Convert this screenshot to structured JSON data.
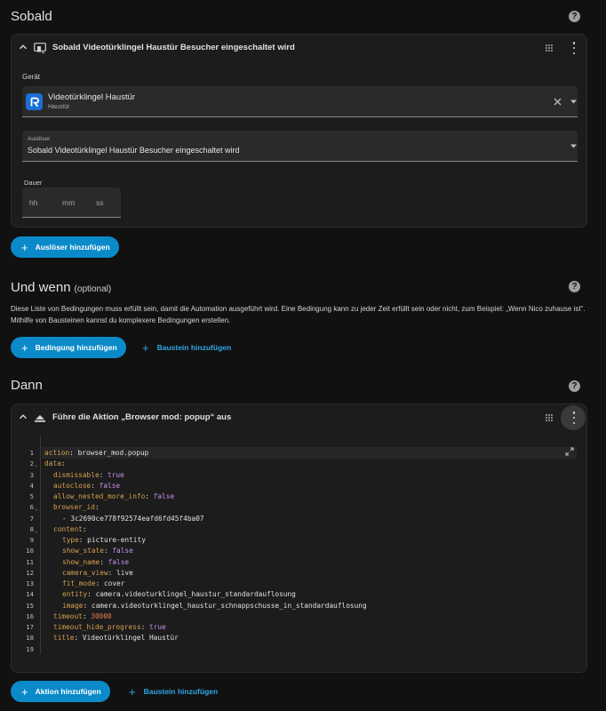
{
  "triggers": {
    "title": "Sobald",
    "help": "?",
    "card_title": "Sobald Videotürklingel Haustür Besucher eingeschaltet wird",
    "device_label": "Gerät",
    "device_name": "Videotürklingel Haustür",
    "device_area": "Haustür",
    "trigger_label": "Auslöser",
    "trigger_value": "Sobald Videotürklingel Haustür Besucher eingeschaltet wird",
    "duration_label": "Dauer",
    "duration_hh": "hh",
    "duration_mm": "mm",
    "duration_ss": "ss",
    "add_button": "Auslöser hinzufügen",
    "plus": "+"
  },
  "conditions": {
    "title": "Und wenn",
    "optional": "(optional)",
    "help": "?",
    "description": "Diese Liste von Bedingungen muss erfüllt sein, damit die Automation ausgeführt wird. Eine Bedingung kann zu jeder Zeit erfüllt sein oder nicht, zum Beispiel: „Wenn Nico zuhause ist“. Mithilfe von Bausteinen kannst du komplexere Bedingungen erstellen.",
    "add_button": "Bedingung hinzufügen",
    "block_button": "Baustein hinzufügen",
    "plus": "+"
  },
  "actions": {
    "title": "Dann",
    "help": "?",
    "card_title": "Führe die Aktion „Browser mod: popup“ aus",
    "add_button": "Aktion hinzufügen",
    "block_button": "Baustein hinzufügen",
    "plus": "+"
  },
  "code": {
    "lines": [
      {
        "n": "1",
        "key": "action",
        "val": "browser_mod.popup"
      },
      {
        "n": "2",
        "key": "data",
        "val": ""
      },
      {
        "n": "3",
        "key": "dismissable",
        "val": "true"
      },
      {
        "n": "4",
        "key": "autoclose",
        "val": "false"
      },
      {
        "n": "5",
        "key": "allow_nested_more_info",
        "val": "false"
      },
      {
        "n": "6",
        "key": "browser_id",
        "val": ""
      },
      {
        "n": "7",
        "key": "",
        "val": "- 3c2690ce778f92574eafd6fd45f4ba07"
      },
      {
        "n": "8",
        "key": "content",
        "val": ""
      },
      {
        "n": "9",
        "key": "type",
        "val": "picture-entity"
      },
      {
        "n": "10",
        "key": "show_state",
        "val": "false"
      },
      {
        "n": "11",
        "key": "show_name",
        "val": "false"
      },
      {
        "n": "12",
        "key": "camera_view",
        "val": "live"
      },
      {
        "n": "13",
        "key": "fit_mode",
        "val": "cover"
      },
      {
        "n": "14",
        "key": "entity",
        "val": "camera.videoturklingel_haustur_standardauflosung"
      },
      {
        "n": "15",
        "key": "image",
        "val": "camera.videoturklingel_haustur_schnappschusse_in_standardauflosung"
      },
      {
        "n": "16",
        "key": "timeout",
        "val": "30000"
      },
      {
        "n": "17",
        "key": "timeout_hide_progress",
        "val": "true"
      },
      {
        "n": "18",
        "key": "title",
        "val": "Videotürklingel Haustür"
      },
      {
        "n": "19",
        "key": "",
        "val": ""
      }
    ]
  },
  "colors": {
    "accent": "#0b8ac9",
    "link": "#30a5e6",
    "yaml_key": "#d6a24e",
    "yaml_bool": "#c792ea",
    "yaml_number": "#e07d4f"
  }
}
